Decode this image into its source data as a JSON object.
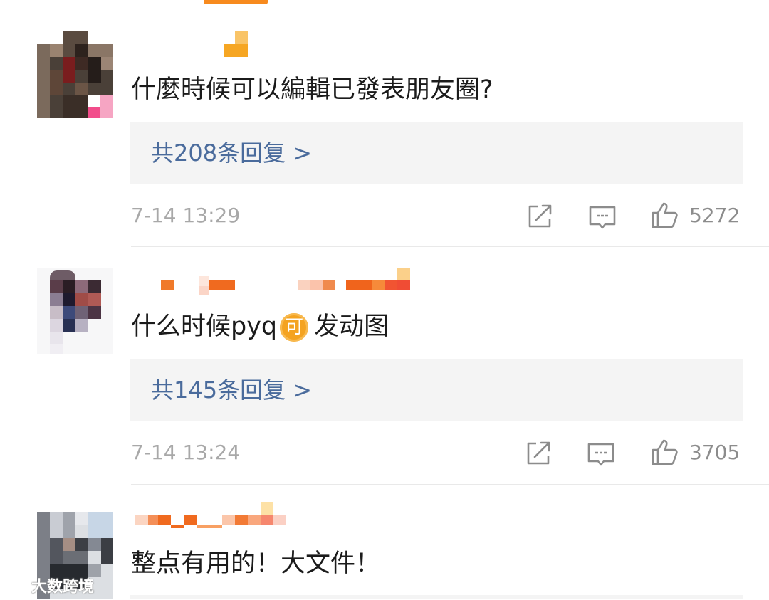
{
  "colors": {
    "accent": "#f78a1e",
    "reply_link": "#4a6b9c",
    "meta_text": "#a8a8a8",
    "reply_bg": "#f4f4f4"
  },
  "comments": [
    {
      "text": "什麼時候可以編輯已發表朋友圈?",
      "replies_label": "共208条回复 >",
      "time": "7-14 13:29",
      "likes": "5272"
    },
    {
      "text_before": "什么时候pyq",
      "badge": "可",
      "text_after": "发动图",
      "replies_label": "共145条回复 >",
      "time": "7-14 13:24",
      "likes": "3705"
    },
    {
      "text": "整点有用的！大文件！"
    }
  ],
  "watermark": "大数跨境",
  "icons": {
    "share": "share-icon",
    "comment": "comment-icon",
    "like": "thumbs-up-icon"
  }
}
